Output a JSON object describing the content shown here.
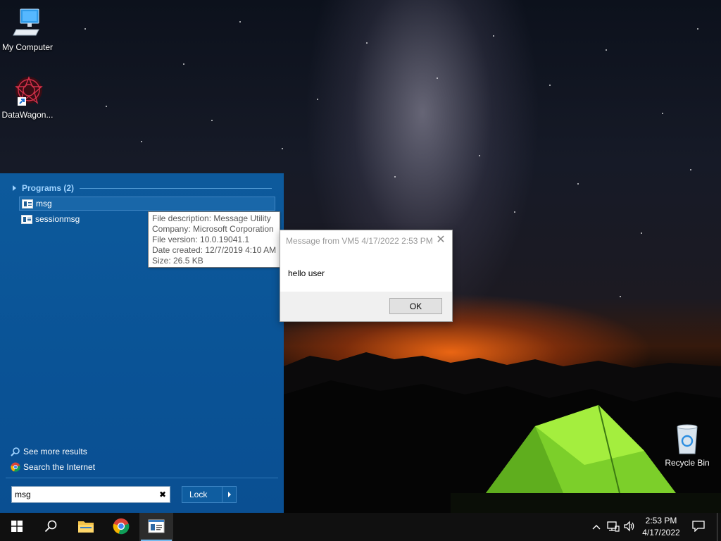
{
  "desktop": {
    "icons": [
      {
        "label": "My Computer",
        "icon": "computer-icon"
      },
      {
        "label": "DataWagon...",
        "icon": "datawagon-icon"
      },
      {
        "label": "Recycle Bin",
        "icon": "recycle-bin-icon"
      }
    ]
  },
  "start_menu": {
    "group_header": "Programs (2)",
    "programs": [
      {
        "label": "msg",
        "selected": true
      },
      {
        "label": "sessionmsg",
        "selected": false
      }
    ],
    "links": [
      {
        "label": "See more results",
        "icon": "search-icon"
      },
      {
        "label": "Search the Internet",
        "icon": "chrome-icon"
      }
    ],
    "search_value": "msg",
    "clear_glyph": "✖",
    "lock_label": "Lock"
  },
  "tooltip": {
    "lines": [
      "File description: Message Utility",
      "Company: Microsoft Corporation",
      "File version: 10.0.19041.1",
      "Date created: 12/7/2019 4:10 AM",
      "Size: 26.5 KB"
    ]
  },
  "dialog": {
    "title": "Message from VM5 4/17/2022 2:53 PM",
    "close_glyph": "✕",
    "message": "hello user",
    "ok_label": "OK"
  },
  "taskbar": {
    "buttons": [
      "windows-start-icon",
      "search-icon",
      "file-explorer-icon",
      "chrome-icon",
      "msg-app-icon"
    ],
    "clock_time": "2:53 PM",
    "clock_date": "4/17/2022",
    "tray_icons": [
      "chevron-up-icon",
      "network-icon",
      "volume-icon",
      "notification-icon"
    ]
  },
  "colors": {
    "start_panel": "#0a5396",
    "accent_link": "#9fd3ff",
    "taskbar": "#101010"
  }
}
